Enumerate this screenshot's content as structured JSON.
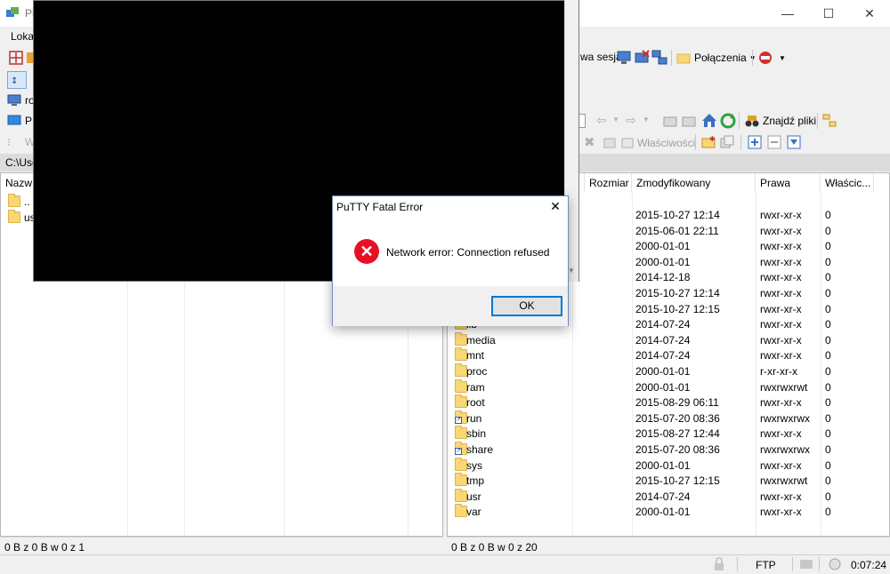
{
  "titlebar": {
    "app_prefix": "Pl",
    "minimize": "—",
    "maximize": "☐",
    "close": "✕"
  },
  "toolbar": {
    "local_menu": "Loka",
    "new_session": "wa sesja",
    "connections": "Połączenia",
    "find_files": "Znajdź pliki",
    "properties": "Właściwości",
    "local_item_ro": "ro",
    "local_item_p": "P",
    "local_item_w": "W"
  },
  "local_panel": {
    "path": "C:\\Use",
    "header_name": "Nazw",
    "items": [
      {
        "name": ".."
      },
      {
        "name": "usr"
      }
    ],
    "status": "0 B z 0 B w 0 z 1"
  },
  "remote_panel": {
    "headers": {
      "size": "Rozmiar",
      "modified": "Zmodyfikowany",
      "rights": "Prawa",
      "owner": "Właścic..."
    },
    "rows": [
      {
        "name": "",
        "modified": "2015-10-27 12:14",
        "rights": "rwxr-xr-x",
        "owner": "0",
        "link": false,
        "hidden": true
      },
      {
        "name": "",
        "modified": "2015-06-01 22:11",
        "rights": "rwxr-xr-x",
        "owner": "0",
        "link": false,
        "hidden": true
      },
      {
        "name": "",
        "modified": "2000-01-01",
        "rights": "rwxr-xr-x",
        "owner": "0",
        "link": false,
        "hidden": true
      },
      {
        "name": "",
        "modified": "2000-01-01",
        "rights": "rwxr-xr-x",
        "owner": "0",
        "link": false,
        "hidden": true
      },
      {
        "name": "",
        "modified": "2014-12-18",
        "rights": "rwxr-xr-x",
        "owner": "0",
        "link": false,
        "hidden": true
      },
      {
        "name": "",
        "modified": "2015-10-27 12:14",
        "rights": "rwxr-xr-x",
        "owner": "0",
        "link": false,
        "hidden": true
      },
      {
        "name": "",
        "modified": "2015-10-27 12:15",
        "rights": "rwxr-xr-x",
        "owner": "0",
        "link": false,
        "hidden": true
      },
      {
        "name": "lib",
        "modified": "2014-07-24",
        "rights": "rwxr-xr-x",
        "owner": "0",
        "link": false,
        "hidden": false
      },
      {
        "name": "media",
        "modified": "2014-07-24",
        "rights": "rwxr-xr-x",
        "owner": "0",
        "link": false,
        "hidden": false
      },
      {
        "name": "mnt",
        "modified": "2014-07-24",
        "rights": "rwxr-xr-x",
        "owner": "0",
        "link": false,
        "hidden": false
      },
      {
        "name": "proc",
        "modified": "2000-01-01",
        "rights": "r-xr-xr-x",
        "owner": "0",
        "link": false,
        "hidden": false
      },
      {
        "name": "ram",
        "modified": "2000-01-01",
        "rights": "rwxrwxrwt",
        "owner": "0",
        "link": false,
        "hidden": false
      },
      {
        "name": "root",
        "modified": "2015-08-29 06:11",
        "rights": "rwxr-xr-x",
        "owner": "0",
        "link": false,
        "hidden": false
      },
      {
        "name": "run",
        "modified": "2015-07-20 08:36",
        "rights": "rwxrwxrwx",
        "owner": "0",
        "link": true,
        "hidden": false
      },
      {
        "name": "sbin",
        "modified": "2015-08-27 12:44",
        "rights": "rwxr-xr-x",
        "owner": "0",
        "link": false,
        "hidden": false
      },
      {
        "name": "share",
        "modified": "2015-07-20 08:36",
        "rights": "rwxrwxrwx",
        "owner": "0",
        "link": true,
        "hidden": false
      },
      {
        "name": "sys",
        "modified": "2000-01-01",
        "rights": "rwxr-xr-x",
        "owner": "0",
        "link": false,
        "hidden": false
      },
      {
        "name": "tmp",
        "modified": "2015-10-27 12:15",
        "rights": "rwxrwxrwt",
        "owner": "0",
        "link": false,
        "hidden": false
      },
      {
        "name": "usr",
        "modified": "2014-07-24",
        "rights": "rwxr-xr-x",
        "owner": "0",
        "link": false,
        "hidden": false
      },
      {
        "name": "var",
        "modified": "2000-01-01",
        "rights": "rwxr-xr-x",
        "owner": "0",
        "link": false,
        "hidden": false
      }
    ],
    "status": "0 B z 0 B w 0 z 20"
  },
  "bottombar": {
    "protocol": "FTP",
    "elapsed": "0:07:24"
  },
  "dialog": {
    "title": "PuTTY Fatal Error",
    "close": "✕",
    "message": "Network error: Connection refused",
    "ok": "OK"
  },
  "colors": {
    "accent": "#0078d7",
    "error": "#e81123",
    "folder": "#f8d775"
  }
}
